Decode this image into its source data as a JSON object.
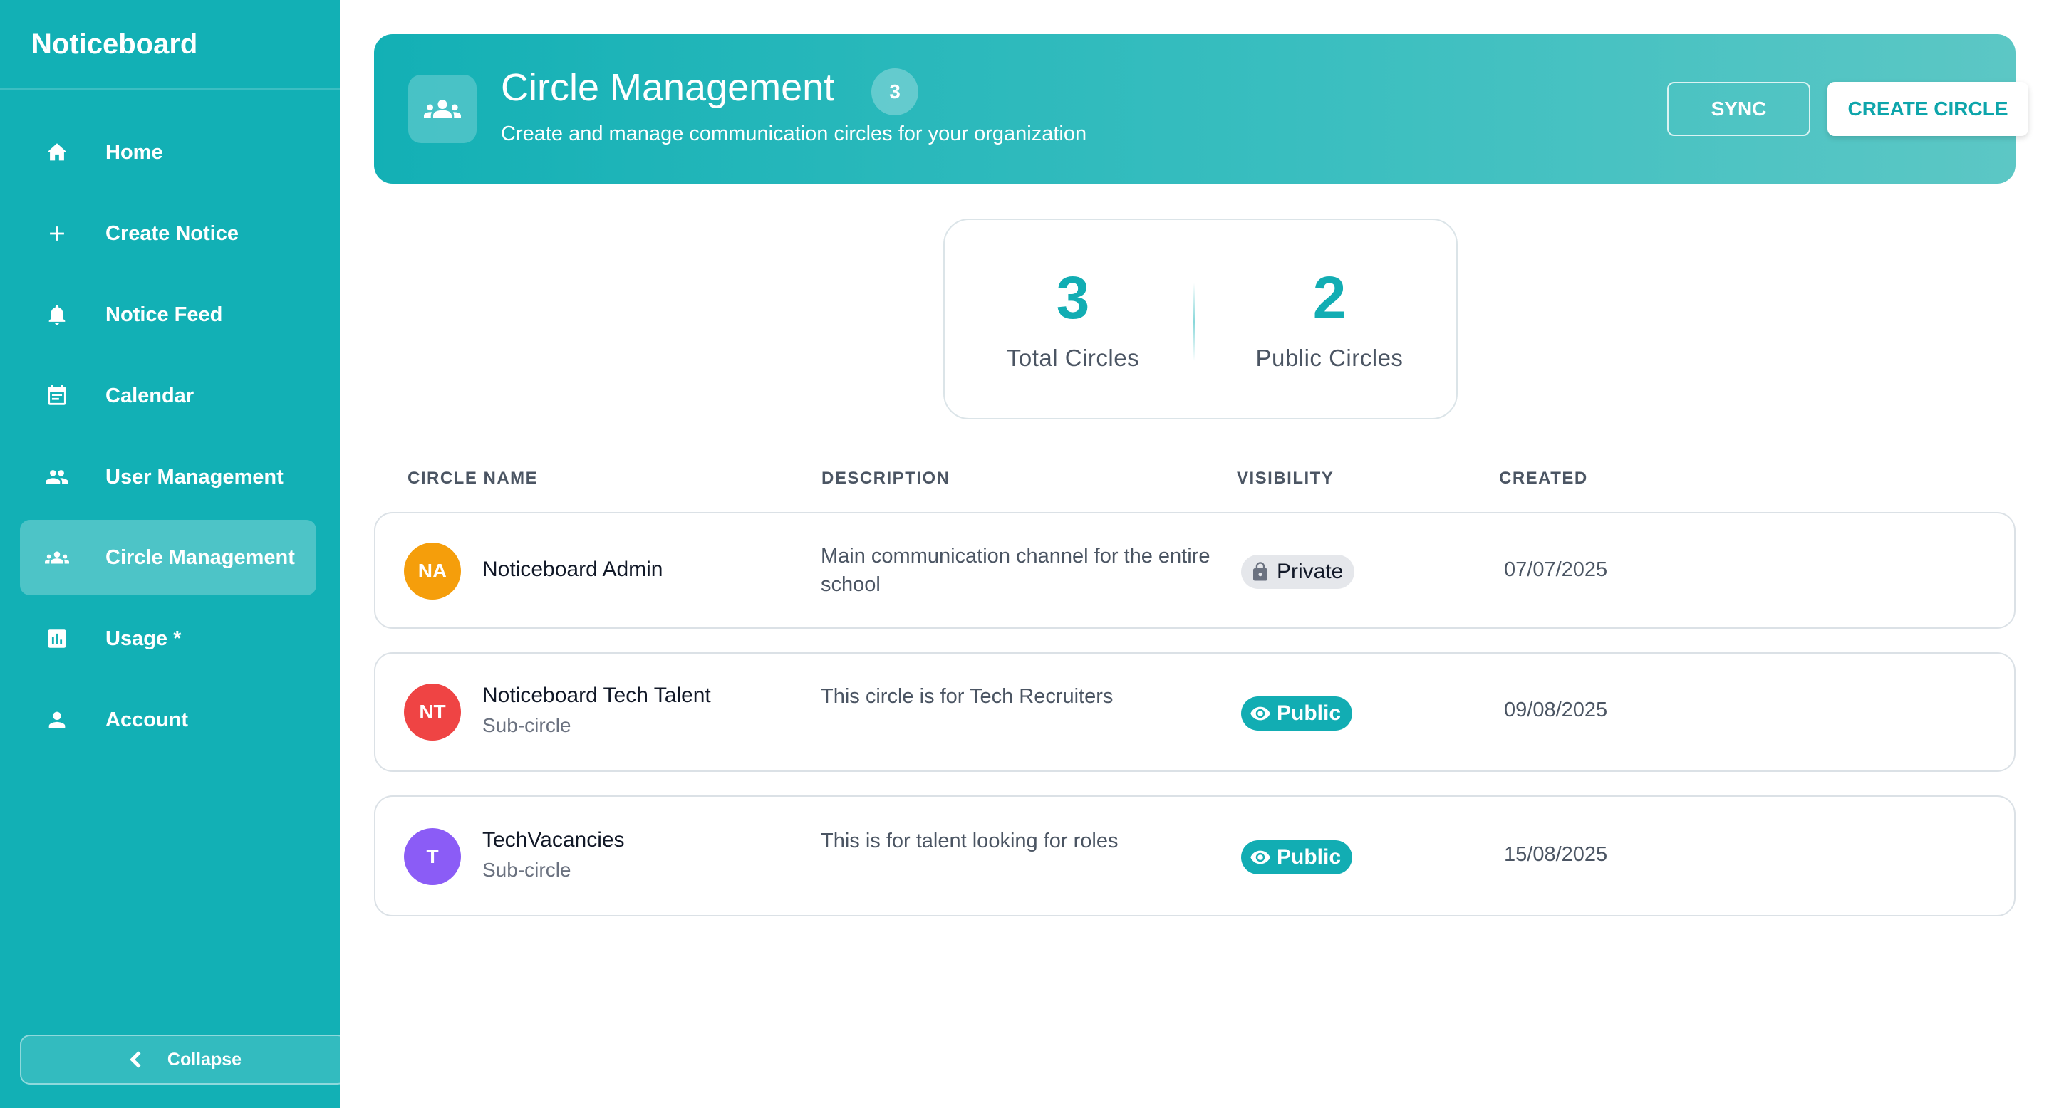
{
  "sidebar": {
    "brand": "Noticeboard",
    "items": [
      {
        "label": "Home",
        "icon": "home-icon"
      },
      {
        "label": "Create Notice",
        "icon": "plus-icon"
      },
      {
        "label": "Notice Feed",
        "icon": "bell-icon"
      },
      {
        "label": "Calendar",
        "icon": "calendar-icon"
      },
      {
        "label": "User Management",
        "icon": "users-icon"
      },
      {
        "label": "Circle Management",
        "icon": "groups-icon",
        "active": true
      },
      {
        "label": "Usage *",
        "icon": "bar-chart-icon"
      },
      {
        "label": "Account",
        "icon": "person-icon"
      }
    ],
    "collapse_label": "Collapse"
  },
  "header": {
    "title": "Circle Management",
    "count": "3",
    "subtitle": "Create and manage communication circles for your organization",
    "sync_label": "SYNC",
    "create_label": "CREATE CIRCLE"
  },
  "stats": {
    "total_value": "3",
    "total_label": "Total Circles",
    "public_value": "2",
    "public_label": "Public Circles"
  },
  "table": {
    "columns": [
      "CIRCLE NAME",
      "DESCRIPTION",
      "VISIBILITY",
      "CREATED"
    ],
    "rows": [
      {
        "initials": "NA",
        "avatar_color": "#f59e0b",
        "name": "Noticeboard Admin",
        "sub": "",
        "description": "Main communication channel for the entire school",
        "visibility": "Private",
        "created": "07/07/2025"
      },
      {
        "initials": "NT",
        "avatar_color": "#ef4444",
        "name": "Noticeboard Tech Talent",
        "sub": "Sub-circle",
        "description": "This circle is for Tech Recruiters",
        "visibility": "Public",
        "created": "09/08/2025"
      },
      {
        "initials": "T",
        "avatar_color": "#8b5cf6",
        "name": "TechVacancies",
        "sub": "Sub-circle",
        "description": "This is for talent looking for roles",
        "visibility": "Public",
        "created": "15/08/2025"
      }
    ]
  },
  "colors": {
    "brand": "#12b0b5",
    "accent_text": "#12adb3"
  }
}
